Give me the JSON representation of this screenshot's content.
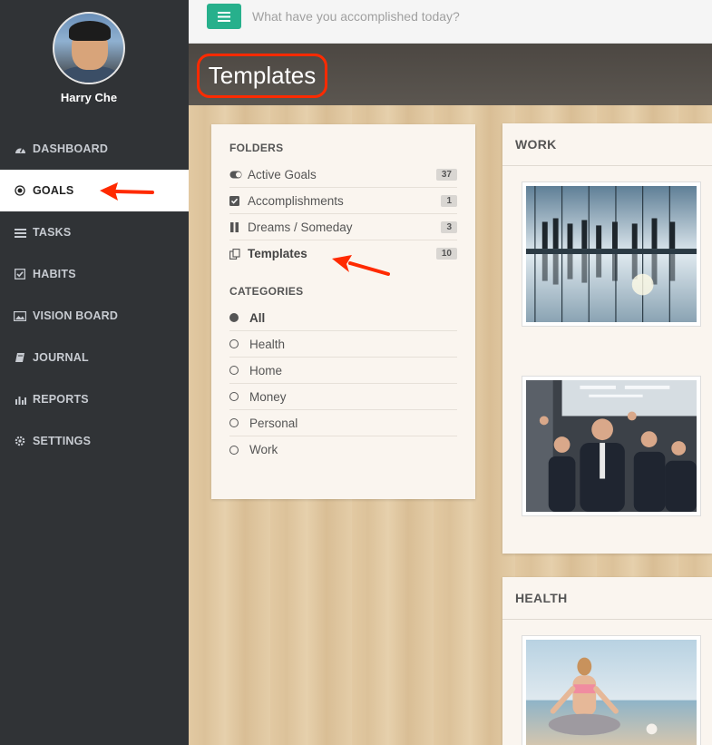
{
  "user": {
    "name": "Harry Che"
  },
  "nav": {
    "items": [
      {
        "label": "DASHBOARD",
        "icon": "dashboard-icon"
      },
      {
        "label": "GOALS",
        "icon": "target-icon"
      },
      {
        "label": "TASKS",
        "icon": "list-icon"
      },
      {
        "label": "HABITS",
        "icon": "check-square-icon"
      },
      {
        "label": "VISION BOARD",
        "icon": "image-icon"
      },
      {
        "label": "JOURNAL",
        "icon": "book-icon"
      },
      {
        "label": "REPORTS",
        "icon": "bar-chart-icon"
      },
      {
        "label": "SETTINGS",
        "icon": "gear-icon"
      }
    ],
    "active_index": 1
  },
  "topbar": {
    "placeholder": "What have you accomplished today?"
  },
  "page": {
    "title": "Templates"
  },
  "folders": {
    "heading": "FOLDERS",
    "items": [
      {
        "label": "Active Goals",
        "count": "37",
        "icon": "toggle-icon"
      },
      {
        "label": "Accomplishments",
        "count": "1",
        "icon": "checkbox-icon"
      },
      {
        "label": "Dreams / Someday",
        "count": "3",
        "icon": "pause-icon"
      },
      {
        "label": "Templates",
        "count": "10",
        "icon": "copy-icon"
      }
    ],
    "selected": "Templates"
  },
  "categories": {
    "heading": "CATEGORIES",
    "items": [
      "All",
      "Health",
      "Home",
      "Money",
      "Personal",
      "Work"
    ],
    "selected": "All"
  },
  "cards": [
    {
      "title": "WORK"
    },
    {
      "title": "HEALTH"
    }
  ],
  "colors": {
    "accent": "#27b08c",
    "highlight": "#ff2a00",
    "sidebar": "#303336"
  }
}
